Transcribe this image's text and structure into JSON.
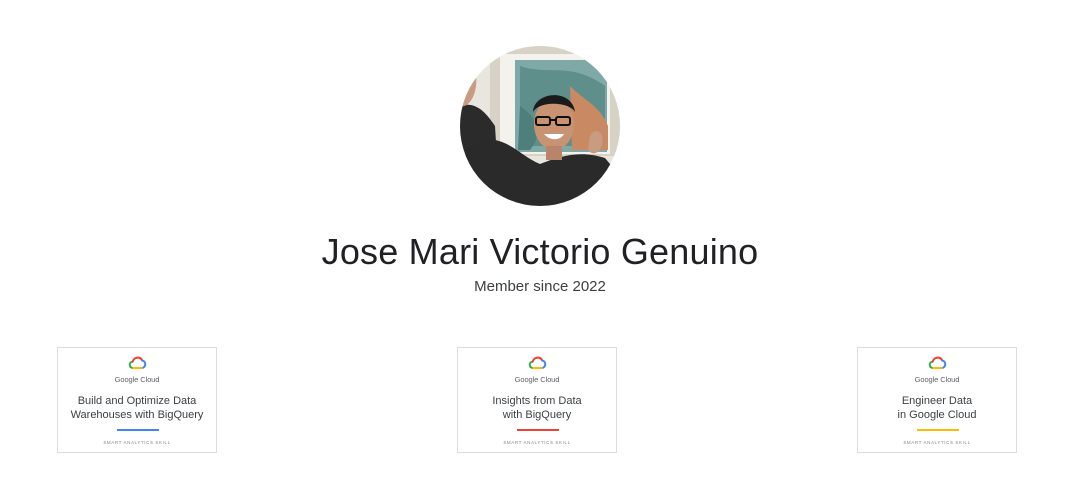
{
  "profile": {
    "name": "Jose Mari Victorio Genuino",
    "member_since": "Member since 2022"
  },
  "badges": [
    {
      "brand": "Google Cloud",
      "title_lines": [
        "Build and Optimize Data",
        "Warehouses with BigQuery"
      ],
      "category": "SMART ANALYTICS SKILL",
      "accent_color": "#4285f4"
    },
    {
      "brand": "Google Cloud",
      "title_lines": [
        "Insights from Data",
        "with BigQuery"
      ],
      "category": "SMART ANALYTICS SKILL",
      "accent_color": "#ea4335"
    },
    {
      "brand": "Google Cloud",
      "title_lines": [
        "Engineer Data",
        "in Google Cloud"
      ],
      "category": "SMART ANALYTICS SKILL",
      "accent_color": "#fbbc04"
    }
  ],
  "icons": {
    "badge_logo": "google-cloud-icon",
    "avatar": "profile-photo"
  }
}
